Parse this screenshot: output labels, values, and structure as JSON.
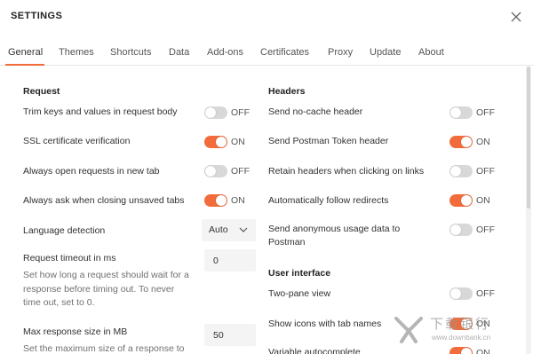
{
  "window": {
    "title": "SETTINGS"
  },
  "tabs": [
    {
      "label": "General"
    },
    {
      "label": "Themes"
    },
    {
      "label": "Shortcuts"
    },
    {
      "label": "Data"
    },
    {
      "label": "Add-ons"
    },
    {
      "label": "Certificates"
    },
    {
      "label": "Proxy"
    },
    {
      "label": "Update"
    },
    {
      "label": "About"
    }
  ],
  "active_tab": "General",
  "accent_color": "#f26b3a",
  "request": {
    "title": "Request",
    "trim_keys": {
      "label": "Trim keys and values in request body",
      "state": "OFF"
    },
    "ssl_verification": {
      "label": "SSL certificate verification",
      "state": "ON"
    },
    "open_in_new_tab": {
      "label": "Always open requests in new tab",
      "state": "OFF"
    },
    "ask_closing_unsaved": {
      "label": "Always ask when closing unsaved tabs",
      "state": "ON"
    },
    "language_detection": {
      "label": "Language detection",
      "value": "Auto"
    },
    "request_timeout": {
      "label": "Request timeout in ms",
      "description": "Set how long a request should wait for a response before timing out. To never time out, set to 0.",
      "value": "0"
    },
    "max_response_size": {
      "label": "Max response size in MB",
      "description": "Set the maximum size of a response to",
      "value": "50"
    }
  },
  "headers": {
    "title": "Headers",
    "no_cache": {
      "label": "Send no-cache header",
      "state": "OFF"
    },
    "postman_token": {
      "label": "Send Postman Token header",
      "state": "ON"
    },
    "retain_headers": {
      "label": "Retain headers when clicking on links",
      "state": "OFF"
    },
    "follow_redirects": {
      "label": "Automatically follow redirects",
      "state": "ON"
    },
    "anonymous_usage": {
      "label": "Send anonymous usage data to Postman",
      "state": "OFF"
    }
  },
  "user_interface": {
    "title": "User interface",
    "two_pane": {
      "label": "Two-pane view",
      "state": "OFF"
    },
    "icons_tab_names": {
      "label": "Show icons with tab names",
      "state": "ON"
    },
    "variable_autocomplete": {
      "label": "Variable autocomplete",
      "state": "ON"
    }
  },
  "watermark": {
    "text": "下载银行",
    "url": "www.downbank.cn"
  }
}
